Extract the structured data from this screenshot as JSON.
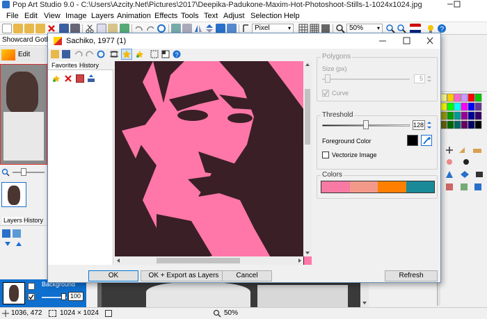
{
  "app": {
    "title": "Pop Art Studio 9.0 - C:\\Users\\Azcity.Net\\Pictures\\2017\\Deepika-Padukone-Maxim-Hot-Photoshoot-Stills-1-1024x1024.jpg"
  },
  "menu": [
    "File",
    "Edit",
    "View",
    "Image",
    "Layers",
    "Animation",
    "Effects",
    "Tools",
    "Text",
    "Adjust",
    "Selection",
    "Help"
  ],
  "toolbar": {
    "mode": "Pixel",
    "zoom": "50%"
  },
  "leftpanel": {
    "font_name": "Showcard Gothic",
    "edit_label": "Edit",
    "tabs": [
      "Layers",
      "History"
    ],
    "layer_name": "Background",
    "layer_opacity": "100"
  },
  "dialog": {
    "title": "Sachiko, 1977 (1)",
    "tabs": [
      "Favorites",
      "History"
    ],
    "polygons": {
      "title": "Polygons",
      "size_label": "Size (px)",
      "size_value": "5",
      "curve_label": "Curve"
    },
    "threshold": {
      "title": "Threshold",
      "value": "128",
      "value_fraction": 0.5,
      "fg_label": "Foreground Color",
      "vectorize_label": "Vectorize Image"
    },
    "colors": {
      "title": "Colors",
      "swatches": [
        "#f67aa4",
        "#f3998a",
        "#ff8000",
        "#1a8a99"
      ]
    },
    "buttons": {
      "ok": "OK",
      "ok_export": "OK + Export as Layers",
      "cancel": "Cancel",
      "refresh": "Refresh"
    }
  },
  "status": {
    "coords": "1036, 472",
    "size": "1024 × 1024",
    "zoom": "50%"
  },
  "colors": {
    "pink": "#ff77a8",
    "dark": "#3a1f26",
    "accent": "#0078d7"
  }
}
